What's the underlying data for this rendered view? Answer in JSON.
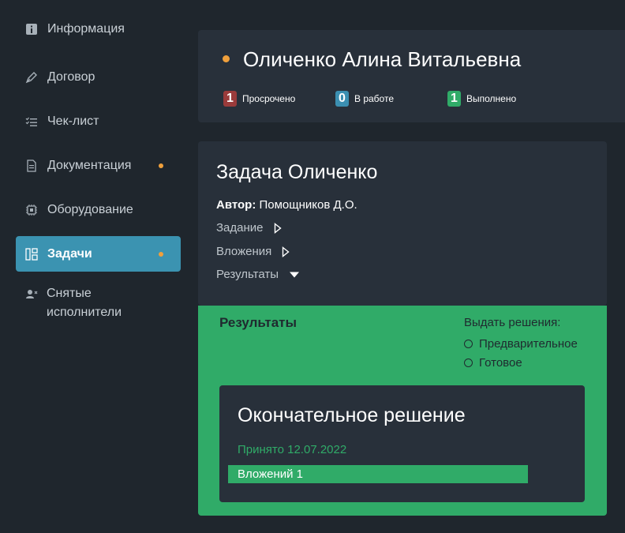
{
  "sidebar": {
    "items": [
      {
        "label": "Информация",
        "icon": "info-icon"
      },
      {
        "label": "Договор",
        "icon": "pen-icon"
      },
      {
        "label": "Чек-лист",
        "icon": "checklist-icon"
      },
      {
        "label": "Документация",
        "icon": "document-icon"
      },
      {
        "label": "Оборудование",
        "icon": "chip-icon"
      },
      {
        "label": "Задачи",
        "icon": "tasks-icon"
      },
      {
        "label": "Снятые исполнители",
        "icon": "user-remove-icon"
      }
    ]
  },
  "header": {
    "name": "Оличенко Алина Витальевна",
    "stats": [
      {
        "count": "1",
        "label": "Просрочено",
        "color": "#9a3b3b"
      },
      {
        "count": "0",
        "label": "В работе",
        "color": "#3b8fb1"
      },
      {
        "count": "1",
        "label": "Выполнено",
        "color": "#30ab68"
      }
    ]
  },
  "task": {
    "title": "Задача Оличенко",
    "author_label": "Автор:",
    "author_value": "Помощников Д.О.",
    "toggles": [
      {
        "label": "Задание",
        "state": "collapsed"
      },
      {
        "label": "Вложения",
        "state": "collapsed"
      },
      {
        "label": "Результаты",
        "state": "expanded"
      }
    ]
  },
  "results": {
    "title": "Результаты",
    "issue_label": "Выдать решения:",
    "options": [
      "Предварительное",
      "Готовое"
    ],
    "final": {
      "title": "Окончательное решение",
      "accepted": "Принято 12.07.2022",
      "attachments": "Вложений 1"
    }
  },
  "colors": {
    "accent": "#3b93b1",
    "success": "#30ab68",
    "warning_dot": "#f0a03c",
    "background": "#1f262d",
    "card": "#28303a"
  }
}
